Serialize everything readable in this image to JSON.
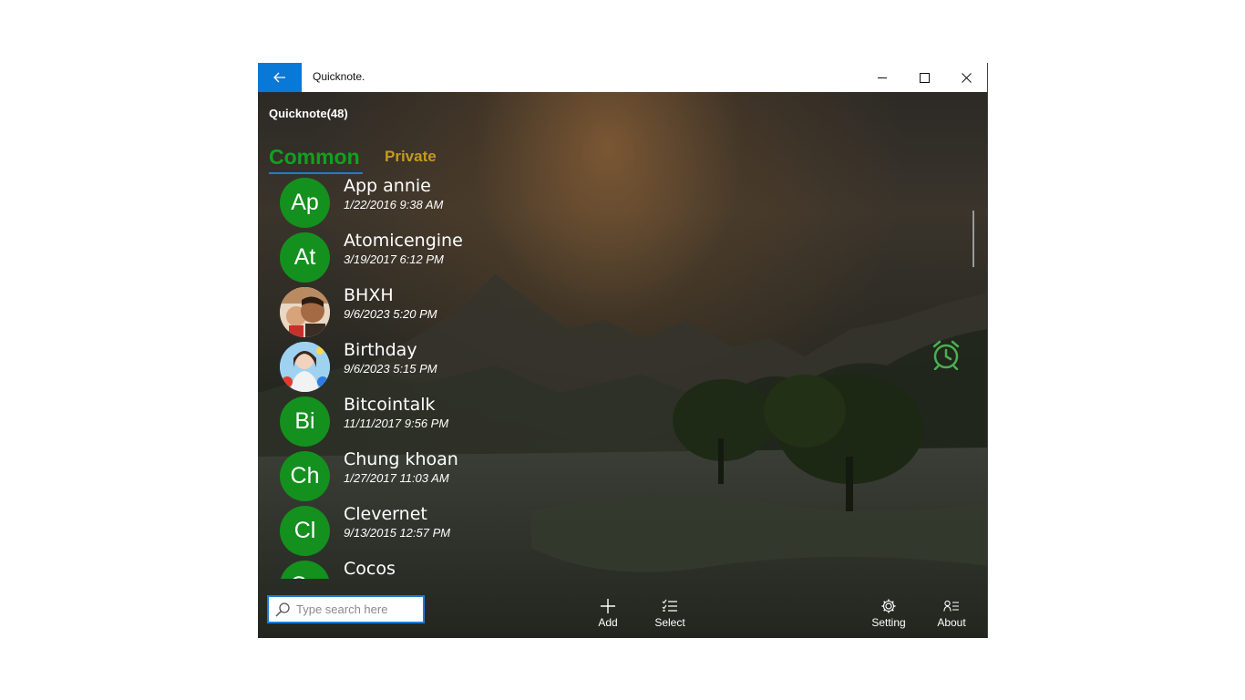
{
  "window": {
    "title": "Quicknote."
  },
  "header": {
    "title": "Quicknote(48)"
  },
  "tabs": [
    {
      "label": "Common",
      "active": true,
      "color": "#12a020"
    },
    {
      "label": "Private",
      "active": false,
      "color": "#c49a22"
    }
  ],
  "notes": [
    {
      "initials": "Ap",
      "title": "App annie",
      "date": "1/22/2016 9:38 AM",
      "avatar": "initials"
    },
    {
      "initials": "At",
      "title": "Atomicengine",
      "date": "3/19/2017 6:12 PM",
      "avatar": "initials"
    },
    {
      "initials": "",
      "title": "BHXH",
      "date": "9/6/2023 5:20 PM",
      "avatar": "photo"
    },
    {
      "initials": "",
      "title": "Birthday",
      "date": "9/6/2023 5:15 PM",
      "avatar": "photo"
    },
    {
      "initials": "Bi",
      "title": "Bitcointalk",
      "date": "11/11/2017 9:56 PM",
      "avatar": "initials"
    },
    {
      "initials": "Ch",
      "title": "Chung khoan",
      "date": "1/27/2017 11:03 AM",
      "avatar": "initials"
    },
    {
      "initials": "Cl",
      "title": "Clevernet",
      "date": "9/13/2015 12:57 PM",
      "avatar": "initials"
    },
    {
      "initials": "Co",
      "title": "Cocos",
      "date": "",
      "avatar": "initials"
    }
  ],
  "search": {
    "placeholder": "Type search here",
    "value": ""
  },
  "commands": {
    "add": "Add",
    "select": "Select",
    "setting": "Setting",
    "about": "About"
  },
  "colors": {
    "accent": "#0a78d7",
    "avatar_green": "#14901e",
    "alarm_green": "#4caf50"
  },
  "icons": [
    "back-arrow-icon",
    "minimize-icon",
    "maximize-icon",
    "close-icon",
    "alarm-clock-icon",
    "search-icon",
    "plus-icon",
    "checklist-icon",
    "gear-icon",
    "contact-info-icon"
  ]
}
